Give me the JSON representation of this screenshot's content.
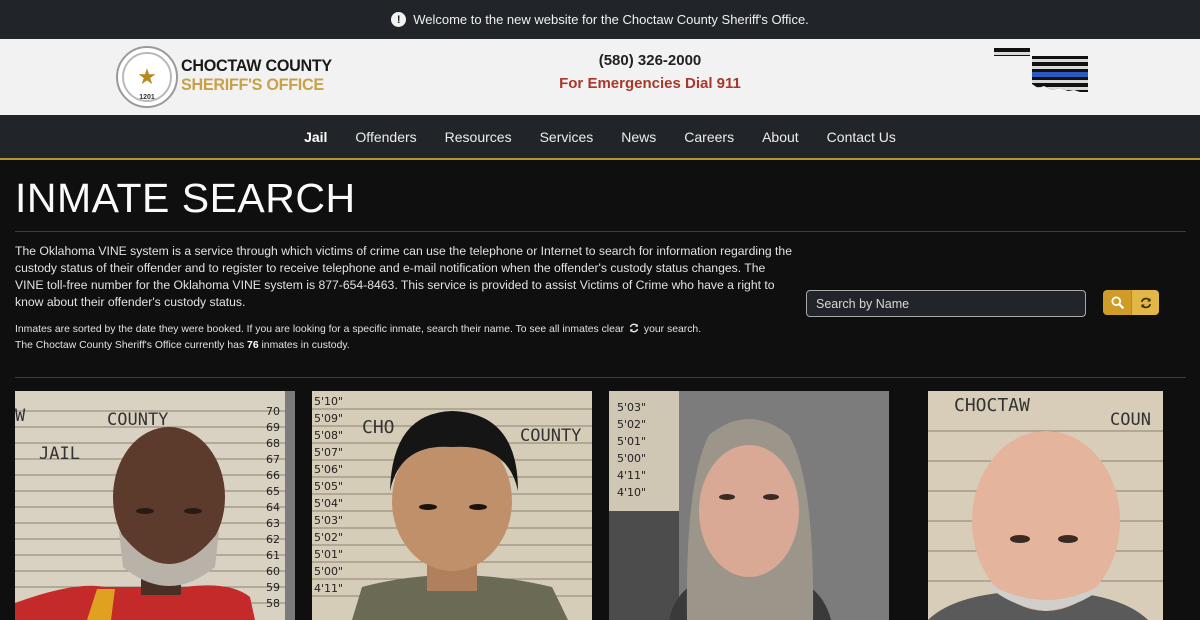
{
  "announcement": {
    "text": "Welcome to the new website for the Choctaw County Sheriff's Office.",
    "icon": "exclamation-circle-icon"
  },
  "brand": {
    "name_line1": "CHOCTAW COUNTY",
    "name_line2": "SHERIFF'S OFFICE",
    "seal_text": "1201",
    "phone": "(580) 326-2000",
    "emergency": "For Emergencies Dial 911"
  },
  "nav": {
    "items": [
      {
        "label": "Jail",
        "active": true
      },
      {
        "label": "Offenders"
      },
      {
        "label": "Resources"
      },
      {
        "label": "Services"
      },
      {
        "label": "News"
      },
      {
        "label": "Careers"
      },
      {
        "label": "About"
      },
      {
        "label": "Contact Us"
      }
    ]
  },
  "page": {
    "title": "INMATE SEARCH",
    "intro": "The Oklahoma VINE system is a service through which victims of crime can use the telephone or Internet to search for information regarding the custody status of their offender and to register to receive telephone and e-mail notification when the offender's custody status changes. The VINE toll-free number for the Oklahoma VINE system is 877-654-8463. This service is provided to assist Victims of Crime who have a right to know about their offender's custody status.",
    "note_before_icon": "Inmates are sorted by the date they were booked. If you are looking for a specific inmate, search their name. To see all inmates clear",
    "note_after_icon": "your search.",
    "count_prefix": "The Choctaw County Sheriff's Office currently has",
    "count": "76",
    "count_suffix": "inmates in custody."
  },
  "search": {
    "placeholder": "Search by Name",
    "value": "",
    "search_icon": "magnifier-icon",
    "reset_icon": "refresh-icon"
  },
  "colors": {
    "accent": "#cf9c27",
    "nav_bg": "#212529",
    "page_bg": "#0f0f0f",
    "emergency": "#a8382a"
  },
  "inmates": [
    {
      "board_text": [
        "W",
        "COUNTY",
        "JAIL"
      ],
      "heights": [
        "70",
        "69",
        "68",
        "67",
        "66",
        "65",
        "64",
        "63",
        "62",
        "61",
        "60",
        "59",
        "58"
      ]
    },
    {
      "board_text": [
        "CHO",
        "COUNTY"
      ],
      "heights": [
        "5'10\"",
        "5'09\"",
        "5'08\"",
        "5'07\"",
        "5'06\"",
        "5'05\"",
        "5'04\"",
        "5'03\"",
        "5'02\"",
        "5'01\"",
        "5'00\"",
        "4'11\""
      ]
    },
    {
      "board_text": [],
      "heights": [
        "5'03\"",
        "5'02\"",
        "5'01\"",
        "5'00\"",
        "4'11\"",
        "4'10\""
      ]
    },
    {
      "board_text": [
        "CHOCTAW",
        "COUN"
      ],
      "heights": []
    }
  ]
}
